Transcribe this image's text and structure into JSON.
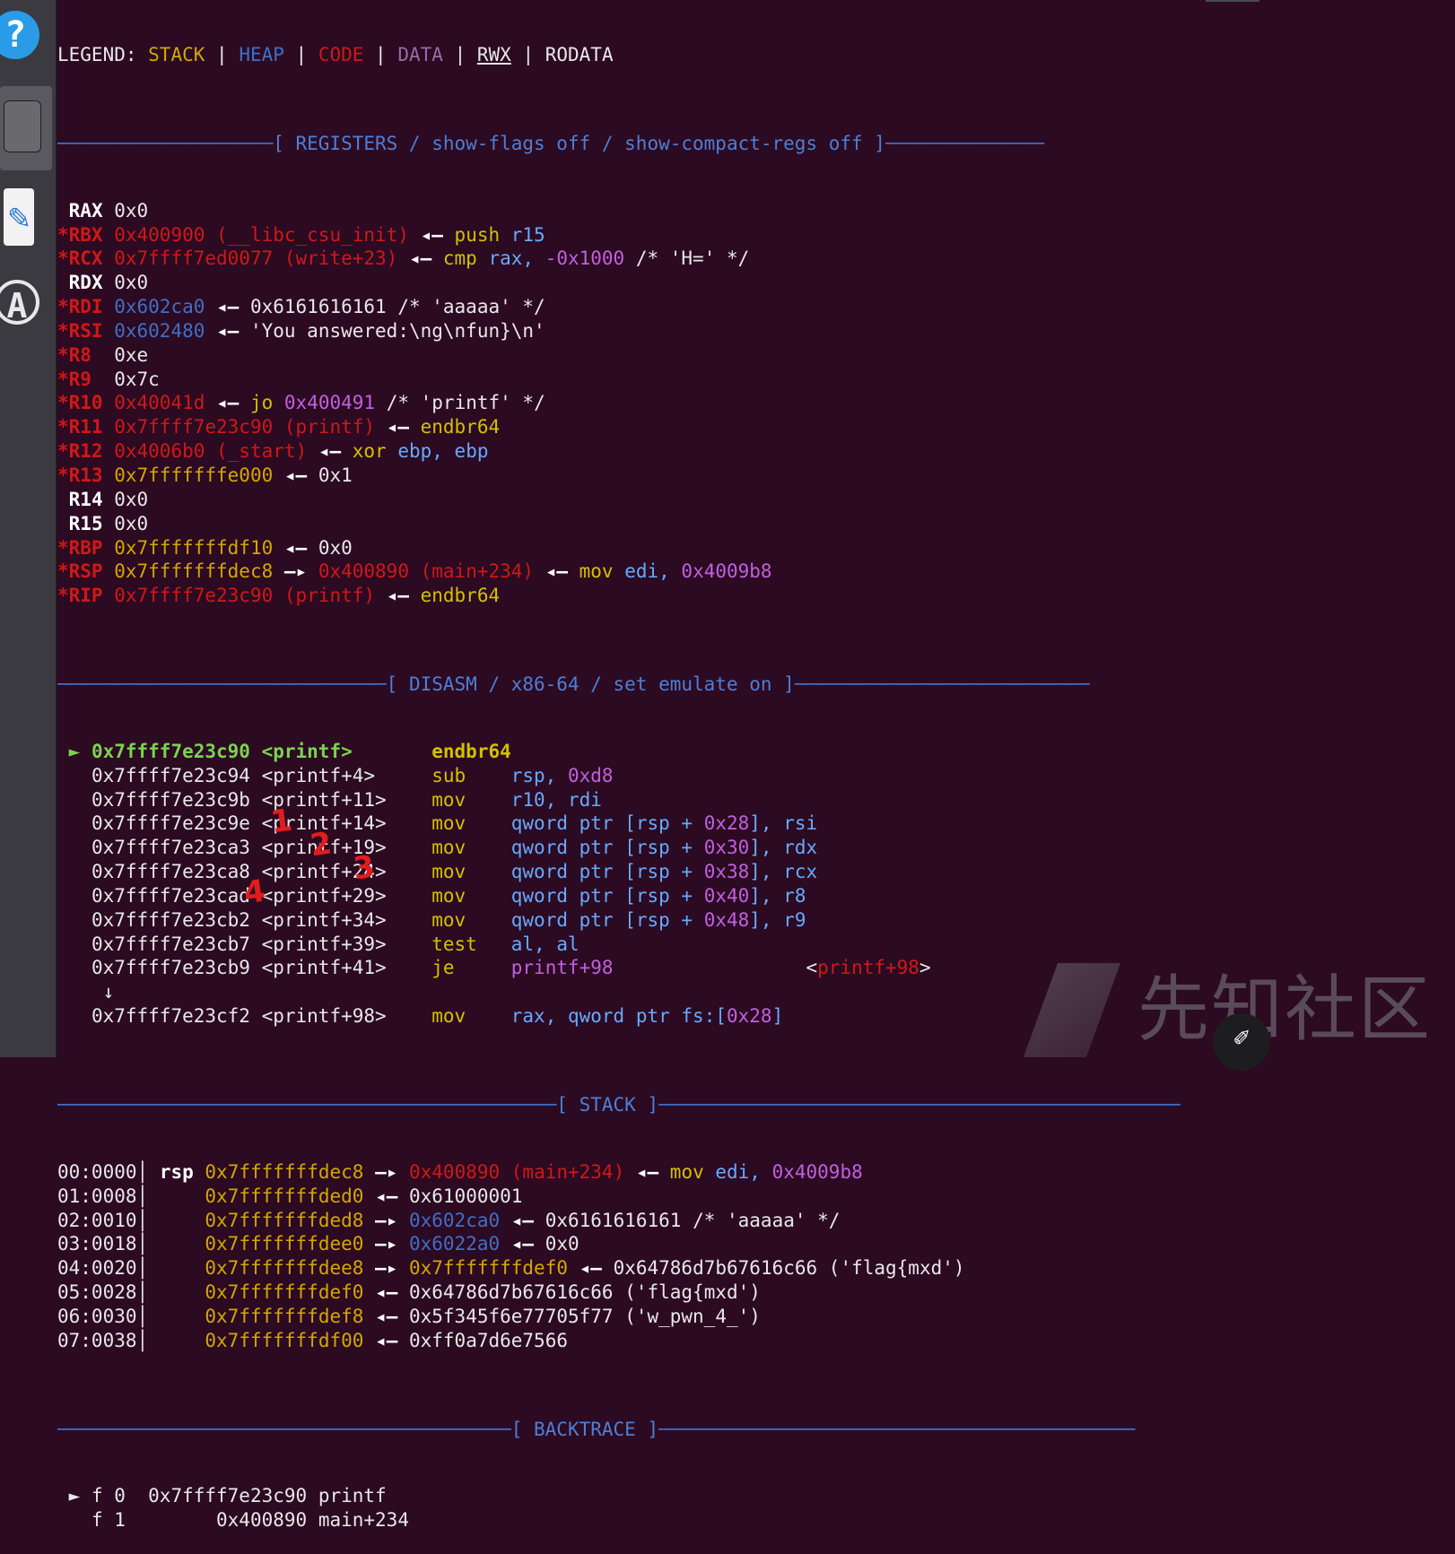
{
  "legend": {
    "prefix": "LEGEND: ",
    "stack": "STACK",
    "heap": "HEAP",
    "code": "CODE",
    "data": "DATA",
    "rwx": "RWX",
    "rodata": "RODATA",
    "sep": " | "
  },
  "headers": {
    "registers": "[ REGISTERS / show-flags off / show-compact-regs off ]",
    "disasm": "[ DISASM / x86-64 / set emulate on ]",
    "stack": "[ STACK ]",
    "backtrace": "[ BACKTRACE ]"
  },
  "registers": [
    {
      "name": "RAX",
      "modified": false,
      "value": "0x0",
      "value_kind": "plain",
      "extra": []
    },
    {
      "name": "*RBX",
      "modified": true,
      "value": "0x400900 (__libc_csu_init)",
      "value_kind": "code",
      "extra": [
        {
          "t": " ◂— ",
          "c": "arrow"
        },
        {
          "t": "push",
          "c": "mn"
        },
        {
          "t": " r15",
          "c": "opr"
        }
      ]
    },
    {
      "name": "*RCX",
      "modified": true,
      "value": "0x7ffff7ed0077 (write+23)",
      "value_kind": "code",
      "extra": [
        {
          "t": " ◂— ",
          "c": "arrow"
        },
        {
          "t": "cmp",
          "c": "mn"
        },
        {
          "t": " rax, ",
          "c": "opr"
        },
        {
          "t": "-0x1000",
          "c": "num"
        },
        {
          "t": " /* 'H=' */",
          "c": "cmt"
        }
      ]
    },
    {
      "name": "RDX",
      "modified": false,
      "value": "0x0",
      "value_kind": "plain",
      "extra": []
    },
    {
      "name": "*RDI",
      "modified": true,
      "value": "0x602ca0",
      "value_kind": "heap",
      "extra": [
        {
          "t": " ◂— ",
          "c": "arrow"
        },
        {
          "t": "0x6161616161 /* 'aaaaa' */",
          "c": "cmt"
        }
      ]
    },
    {
      "name": "*RSI",
      "modified": true,
      "value": "0x602480",
      "value_kind": "heap",
      "extra": [
        {
          "t": " ◂— ",
          "c": "arrow"
        },
        {
          "t": "'You answered:\\ng\\nfun}\\n'",
          "c": "cmt"
        }
      ]
    },
    {
      "name": "*R8",
      "modified": true,
      "value": "0xe",
      "value_kind": "plain",
      "extra": []
    },
    {
      "name": "*R9",
      "modified": true,
      "value": "0x7c",
      "value_kind": "plain",
      "extra": []
    },
    {
      "name": "*R10",
      "modified": true,
      "value": "0x40041d",
      "value_kind": "code",
      "extra": [
        {
          "t": " ◂— ",
          "c": "arrow"
        },
        {
          "t": "jo",
          "c": "mn"
        },
        {
          "t": " 0x400491",
          "c": "num"
        },
        {
          "t": " /* 'printf' */",
          "c": "cmt"
        }
      ]
    },
    {
      "name": "*R11",
      "modified": true,
      "value": "0x7ffff7e23c90 (printf)",
      "value_kind": "code",
      "extra": [
        {
          "t": " ◂— ",
          "c": "arrow"
        },
        {
          "t": "endbr64",
          "c": "mn"
        }
      ]
    },
    {
      "name": "*R12",
      "modified": true,
      "value": "0x4006b0 (_start)",
      "value_kind": "code",
      "extra": [
        {
          "t": " ◂— ",
          "c": "arrow"
        },
        {
          "t": "xor",
          "c": "mn"
        },
        {
          "t": " ebp, ebp",
          "c": "opr"
        }
      ]
    },
    {
      "name": "*R13",
      "modified": true,
      "value": "0x7fffffffe000",
      "value_kind": "stack",
      "extra": [
        {
          "t": " ◂— ",
          "c": "arrow"
        },
        {
          "t": "0x1",
          "c": "cmt"
        }
      ]
    },
    {
      "name": "R14",
      "modified": false,
      "value": "0x0",
      "value_kind": "plain",
      "extra": []
    },
    {
      "name": "R15",
      "modified": false,
      "value": "0x0",
      "value_kind": "plain",
      "extra": []
    },
    {
      "name": "*RBP",
      "modified": true,
      "value": "0x7fffffffdf10",
      "value_kind": "stack",
      "extra": [
        {
          "t": " ◂— ",
          "c": "arrow"
        },
        {
          "t": "0x0",
          "c": "cmt"
        }
      ]
    },
    {
      "name": "*RSP",
      "modified": true,
      "value": "0x7fffffffdec8",
      "value_kind": "stack",
      "extra": [
        {
          "t": " —▸ ",
          "c": "arrow"
        },
        {
          "t": "0x400890 (main+234)",
          "c": "code"
        },
        {
          "t": " ◂— ",
          "c": "arrow"
        },
        {
          "t": "mov",
          "c": "mn"
        },
        {
          "t": " edi, ",
          "c": "opr"
        },
        {
          "t": "0x4009b8",
          "c": "num"
        }
      ]
    },
    {
      "name": "*RIP",
      "modified": true,
      "value": "0x7ffff7e23c90 (printf)",
      "value_kind": "code",
      "extra": [
        {
          "t": " ◂— ",
          "c": "arrow"
        },
        {
          "t": "endbr64",
          "c": "mn"
        }
      ]
    }
  ],
  "disasm": [
    {
      "current": true,
      "addr": "0x7ffff7e23c90 <printf>",
      "mn": "endbr64",
      "ops": []
    },
    {
      "current": false,
      "addr": "0x7ffff7e23c94 <printf+4>",
      "mn": "sub",
      "ops": [
        {
          "t": "rsp, ",
          "c": "opr"
        },
        {
          "t": "0xd8",
          "c": "num"
        }
      ]
    },
    {
      "current": false,
      "addr": "0x7ffff7e23c9b <printf+11>",
      "mn": "mov",
      "ops": [
        {
          "t": "r10, rdi",
          "c": "opr"
        }
      ]
    },
    {
      "current": false,
      "addr": "0x7ffff7e23c9e <printf+14>",
      "mn": "mov",
      "ops": [
        {
          "t": "qword ptr [rsp + ",
          "c": "opr"
        },
        {
          "t": "0x28",
          "c": "num"
        },
        {
          "t": "], rsi",
          "c": "opr"
        }
      ]
    },
    {
      "current": false,
      "addr": "0x7ffff7e23ca3 <printf+19>",
      "mn": "mov",
      "ops": [
        {
          "t": "qword ptr [rsp + ",
          "c": "opr"
        },
        {
          "t": "0x30",
          "c": "num"
        },
        {
          "t": "], rdx",
          "c": "opr"
        }
      ]
    },
    {
      "current": false,
      "addr": "0x7ffff7e23ca8 <printf+24>",
      "mn": "mov",
      "ops": [
        {
          "t": "qword ptr [rsp + ",
          "c": "opr"
        },
        {
          "t": "0x38",
          "c": "num"
        },
        {
          "t": "], rcx",
          "c": "opr"
        }
      ]
    },
    {
      "current": false,
      "addr": "0x7ffff7e23cad <printf+29>",
      "mn": "mov",
      "ops": [
        {
          "t": "qword ptr [rsp + ",
          "c": "opr"
        },
        {
          "t": "0x40",
          "c": "num"
        },
        {
          "t": "], r8",
          "c": "opr"
        }
      ]
    },
    {
      "current": false,
      "addr": "0x7ffff7e23cb2 <printf+34>",
      "mn": "mov",
      "ops": [
        {
          "t": "qword ptr [rsp + ",
          "c": "opr"
        },
        {
          "t": "0x48",
          "c": "num"
        },
        {
          "t": "], r9",
          "c": "opr"
        }
      ]
    },
    {
      "current": false,
      "addr": "0x7ffff7e23cb7 <printf+39>",
      "mn": "test",
      "ops": [
        {
          "t": "al, al",
          "c": "opr"
        }
      ]
    },
    {
      "current": false,
      "addr": "0x7ffff7e23cb9 <printf+41>",
      "mn": "je",
      "ops": [
        {
          "t": "printf+98",
          "c": "num"
        },
        {
          "t": "                 <",
          "c": "cmt"
        },
        {
          "t": "printf+98",
          "c": "code"
        },
        {
          "t": ">",
          "c": "cmt"
        }
      ]
    },
    {
      "jump_arrow": "↓"
    },
    {
      "current": false,
      "addr": "0x7ffff7e23cf2 <printf+98>",
      "mn": "mov",
      "ops": [
        {
          "t": "rax, qword ptr fs:[",
          "c": "opr"
        },
        {
          "t": "0x28",
          "c": "num"
        },
        {
          "t": "]",
          "c": "opr"
        }
      ]
    }
  ],
  "stack": [
    {
      "idx": "00:0000",
      "reg": "rsp",
      "addr": "0x7fffffffdec8",
      "rest": [
        {
          "t": " —▸ ",
          "c": "arrow"
        },
        {
          "t": "0x400890 (main+234)",
          "c": "code"
        },
        {
          "t": " ◂— ",
          "c": "arrow"
        },
        {
          "t": "mov",
          "c": "mn"
        },
        {
          "t": " edi, ",
          "c": "opr"
        },
        {
          "t": "0x4009b8",
          "c": "num"
        }
      ]
    },
    {
      "idx": "01:0008",
      "reg": "",
      "addr": "0x7fffffffded0",
      "rest": [
        {
          "t": " ◂— ",
          "c": "arrow"
        },
        {
          "t": "0x61000001",
          "c": "cmt"
        }
      ]
    },
    {
      "idx": "02:0010",
      "reg": "",
      "addr": "0x7fffffffded8",
      "rest": [
        {
          "t": " —▸ ",
          "c": "arrow"
        },
        {
          "t": "0x602ca0",
          "c": "heap"
        },
        {
          "t": " ◂— ",
          "c": "arrow"
        },
        {
          "t": "0x6161616161 /* 'aaaaa' */",
          "c": "cmt"
        }
      ]
    },
    {
      "idx": "03:0018",
      "reg": "",
      "addr": "0x7fffffffdee0",
      "rest": [
        {
          "t": " —▸ ",
          "c": "arrow"
        },
        {
          "t": "0x6022a0",
          "c": "heap"
        },
        {
          "t": " ◂— ",
          "c": "arrow"
        },
        {
          "t": "0x0",
          "c": "cmt"
        }
      ]
    },
    {
      "idx": "04:0020",
      "reg": "",
      "addr": "0x7fffffffdee8",
      "rest": [
        {
          "t": " —▸ ",
          "c": "arrow"
        },
        {
          "t": "0x7fffffffdef0",
          "c": "stack"
        },
        {
          "t": " ◂— ",
          "c": "arrow"
        },
        {
          "t": "0x64786d7b67616c66 ('flag{mxd')",
          "c": "cmt"
        }
      ]
    },
    {
      "idx": "05:0028",
      "reg": "",
      "addr": "0x7fffffffdef0",
      "rest": [
        {
          "t": " ◂— ",
          "c": "arrow"
        },
        {
          "t": "0x64786d7b67616c66 ('flag{mxd')",
          "c": "cmt"
        }
      ]
    },
    {
      "idx": "06:0030",
      "reg": "",
      "addr": "0x7fffffffdef8",
      "rest": [
        {
          "t": " ◂— ",
          "c": "arrow"
        },
        {
          "t": "0x5f345f6e77705f77 ('w_pwn_4_')",
          "c": "cmt"
        }
      ]
    },
    {
      "idx": "07:0038",
      "reg": "",
      "addr": "0x7fffffffdf00",
      "rest": [
        {
          "t": " ◂— ",
          "c": "arrow"
        },
        {
          "t": "0xff0a7d6e7566",
          "c": "cmt"
        }
      ]
    }
  ],
  "backtrace": [
    {
      "marker": "► f 0",
      "addr": "  0x7ffff7e23c90",
      "sym": " printf"
    },
    {
      "marker": "  f 1",
      "addr": "        0x400890",
      "sym": " main+234"
    }
  ],
  "annotations": [
    "1",
    "2",
    "3",
    "4"
  ],
  "watermark": "先知社区",
  "dock": {
    "help_glyph": "?",
    "editor_glyph": "✎",
    "store_glyph": "A"
  },
  "edit_fab_glyph": "✐"
}
